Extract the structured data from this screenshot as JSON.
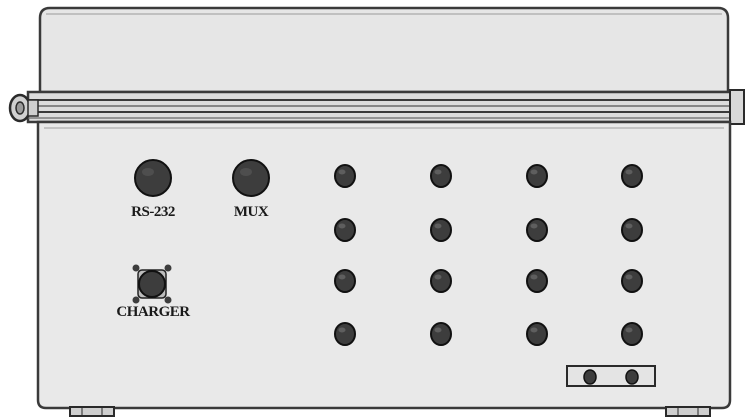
{
  "connectors": {
    "rs232_label": "RS-232",
    "mux_label": "MUX",
    "charger_label": "CHARGER"
  },
  "colors": {
    "enclosure_fill": "#e9e9e9",
    "enclosure_stroke": "#3a3a3a",
    "port_fill": "#3d3d3d",
    "port_stroke": "#111111"
  },
  "port_grid": {
    "rows": 4,
    "columns": 4
  },
  "vent_ports": 2
}
